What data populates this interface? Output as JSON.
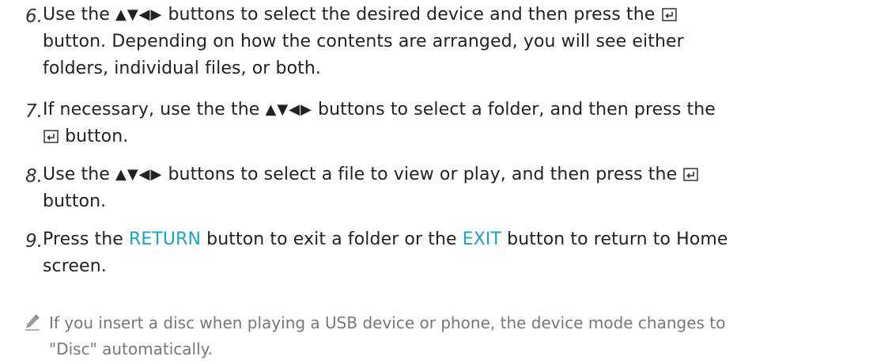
{
  "steps": [
    {
      "number": "6.",
      "parts": {
        "a": "Use the",
        "arrows": "▲▼◀▶",
        "b": "buttons to select the desired device and then press the",
        "c": "button. Depending on how the contents are arranged, you will see either",
        "d": "folders, individual files, or both."
      }
    },
    {
      "number": "7.",
      "parts": {
        "a": "If necessary, use the the",
        "arrows": "▲▼◀▶",
        "b": "buttons to select a folder, and then press the",
        "c": "button."
      }
    },
    {
      "number": "8.",
      "parts": {
        "a": "Use the",
        "arrows": "▲▼◀▶",
        "b": "buttons to select a file to view or play, and then press the",
        "c": "button."
      }
    },
    {
      "number": "9.",
      "parts": {
        "a": "Press the",
        "return": "RETURN",
        "b": "button to exit a folder or the",
        "exit": "EXIT",
        "c": "button to return to Home",
        "d": "screen."
      }
    }
  ],
  "note": {
    "icon": "pencil-icon",
    "text_line1": "If you insert a disc when playing a USB device or phone, the device mode changes to",
    "text_line2": "\"Disc\" automatically."
  },
  "colors": {
    "highlight": "#1aa3c8",
    "body_text": "#222222",
    "note_text": "#777777"
  }
}
